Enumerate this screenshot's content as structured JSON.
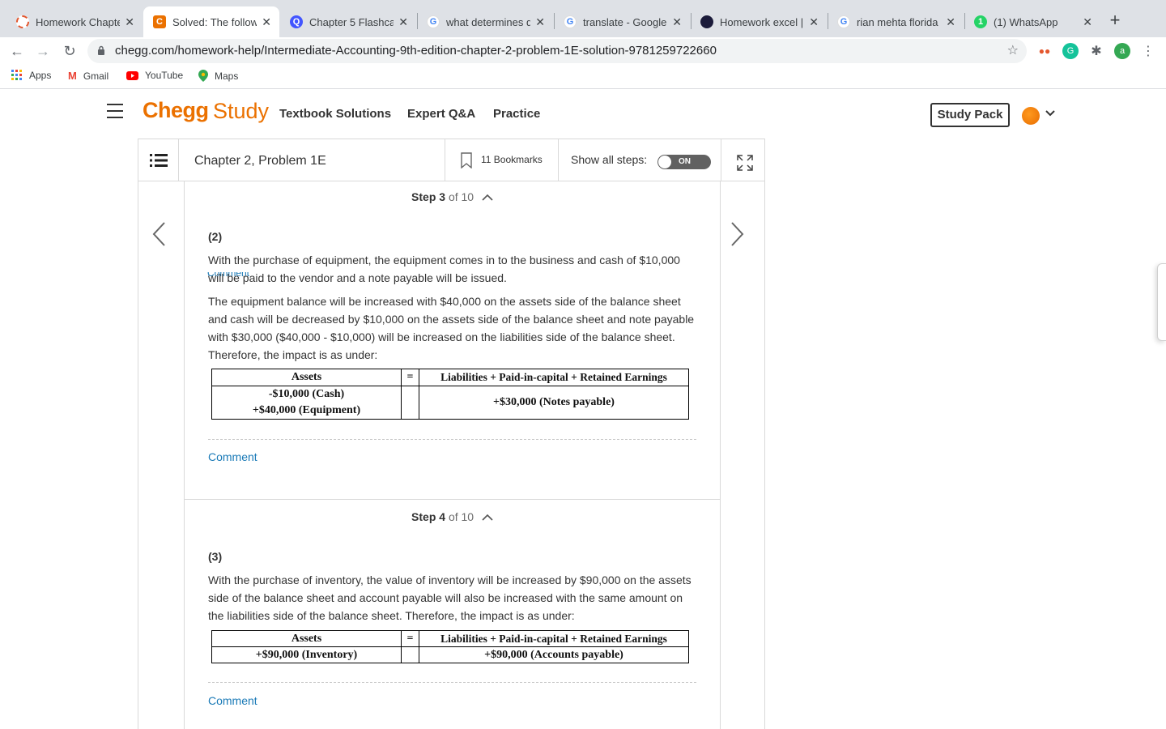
{
  "browser": {
    "tabs": [
      {
        "title": "Homework Chapte",
        "favicon_color": "#e4572e",
        "active": false
      },
      {
        "title": "Solved: The follow",
        "favicon_color": "#eb7100",
        "favicon_letter": "C",
        "active": true
      },
      {
        "title": "Chapter 5 Flashca",
        "favicon_color": "#4255ff",
        "favicon_letter": "Q",
        "active": false
      },
      {
        "title": "what determines d",
        "favicon_color": "#4285f4",
        "favicon_letter": "G",
        "active": false
      },
      {
        "title": "translate - Google",
        "favicon_color": "#4285f4",
        "favicon_letter": "G",
        "active": false
      },
      {
        "title": "Homework excel |",
        "favicon_color": "#1b1b3a",
        "active": false
      },
      {
        "title": "rian mehta florida",
        "favicon_color": "#4285f4",
        "favicon_letter": "G",
        "active": false
      },
      {
        "title": "(1) WhatsApp",
        "favicon_color": "#25d366",
        "favicon_letter": "1",
        "active": false
      }
    ],
    "url": "chegg.com/homework-help/Intermediate-Accounting-9th-edition-chapter-2-problem-1E-solution-9781259722660",
    "profile_letter": "a",
    "bookmarks": [
      {
        "label": "Apps"
      },
      {
        "label": "Gmail"
      },
      {
        "label": "YouTube"
      },
      {
        "label": "Maps"
      }
    ]
  },
  "header": {
    "logo_chegg": "Chegg",
    "logo_study": "Study",
    "nav": [
      "Textbook Solutions",
      "Expert Q&A",
      "Practice"
    ],
    "study_pack": "Study Pack"
  },
  "panel": {
    "chapter_title": "Chapter 2, Problem 1E",
    "bookmarks_count": "11 Bookmarks",
    "show_all_steps": "Show all steps:",
    "toggle_label": "ON",
    "prev_comment_cut": "Comment"
  },
  "steps": [
    {
      "step_label": "Step 3",
      "of_label": "of 10",
      "part": "(2)",
      "paragraphs": [
        "With the purchase of equipment, the equipment comes in to the business and cash of $10,000 will be paid to the vendor and a note payable will be issued.",
        "The equipment balance will be increased with $40,000 on the assets side of the balance sheet and cash will be decreased by $10,000 on the assets side of the balance sheet and note payable with $30,000 ($40,000 - $10,000) will be increased on the liabilities side of the balance sheet. Therefore, the impact is as under:"
      ],
      "table": {
        "header_assets": "Assets",
        "header_eq": "=",
        "header_liab": "Liabilities + Paid-in-capital + Retained Earnings",
        "assets_line1": "-$10,000 (Cash)",
        "assets_line2": "+$40,000 (Equipment)",
        "liab": "+$30,000 (Notes payable)"
      },
      "comment": "Comment"
    },
    {
      "step_label": "Step 4",
      "of_label": "of 10",
      "part": "(3)",
      "paragraphs": [
        "With the purchase of inventory, the value of inventory will be increased by $90,000 on the assets side of the balance sheet and account payable will also be increased with the same amount on the liabilities side of the balance sheet. Therefore, the impact is as under:"
      ],
      "table": {
        "header_assets": "Assets",
        "header_eq": "=",
        "header_liab": "Liabilities + Paid-in-capital + Retained Earnings",
        "assets": "+$90,000 (Inventory)",
        "liab": "+$90,000 (Accounts payable)"
      },
      "comment": "Comment"
    }
  ]
}
